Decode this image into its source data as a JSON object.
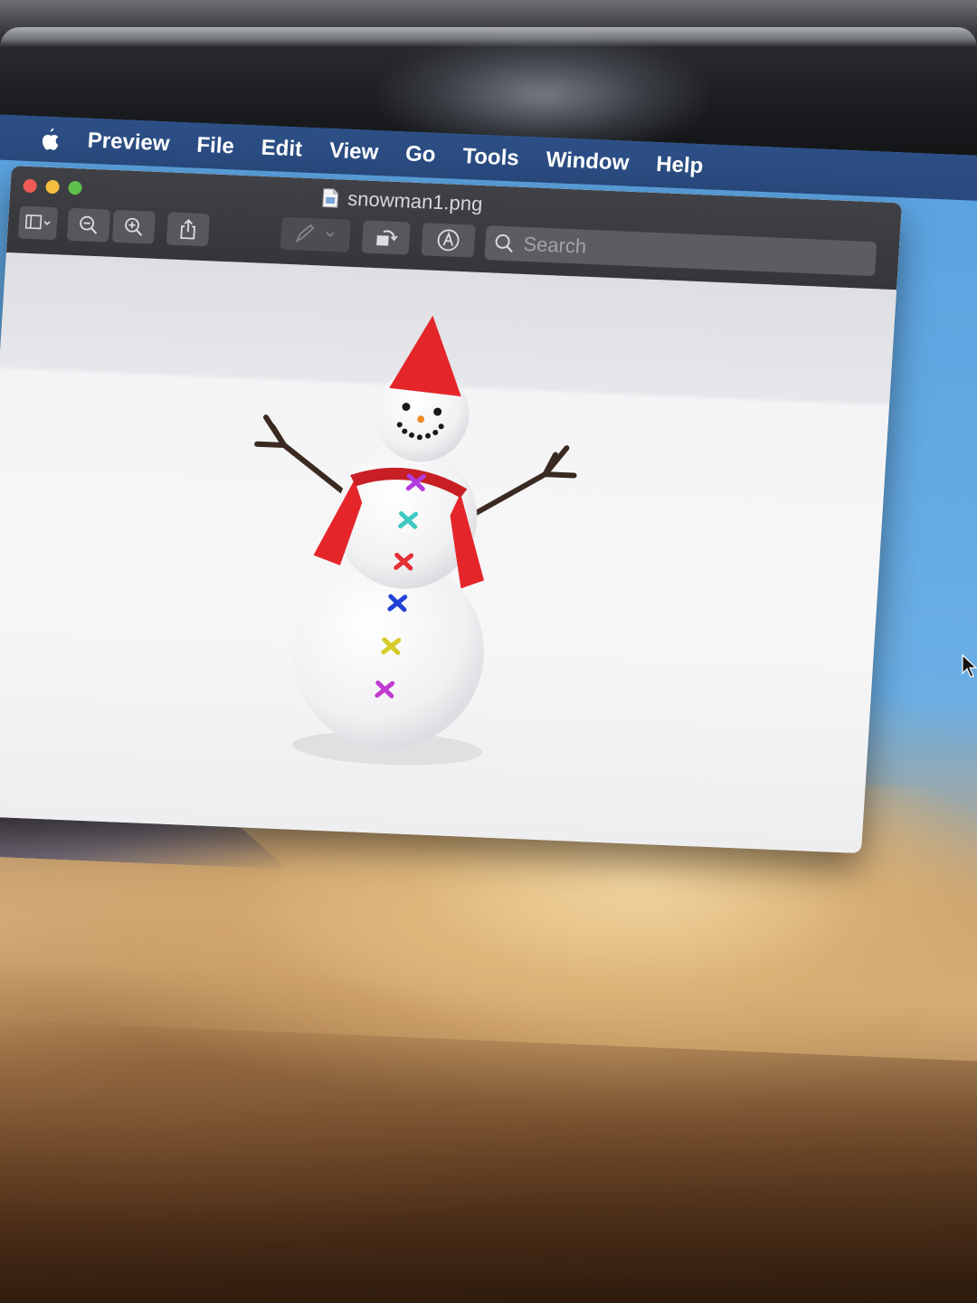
{
  "menubar": {
    "items": [
      "Preview",
      "File",
      "Edit",
      "View",
      "Go",
      "Tools",
      "Window",
      "Help"
    ]
  },
  "window": {
    "title": "snowman1.png",
    "search": {
      "placeholder": "Search",
      "value": ""
    }
  },
  "colors": {
    "menubar": "#2c4f86",
    "titlebar": "#3a3b40",
    "close": "#ee5b56",
    "minimize": "#f3bd3d",
    "zoom": "#5fc04b"
  },
  "icons": {
    "menubar": "apple-logo",
    "toolbar": [
      "sidebar-toggle-icon",
      "zoom-out-icon",
      "zoom-in-icon",
      "share-icon",
      "markup-pen-icon",
      "rotate-icon",
      "annotate-icon",
      "search-icon"
    ]
  }
}
